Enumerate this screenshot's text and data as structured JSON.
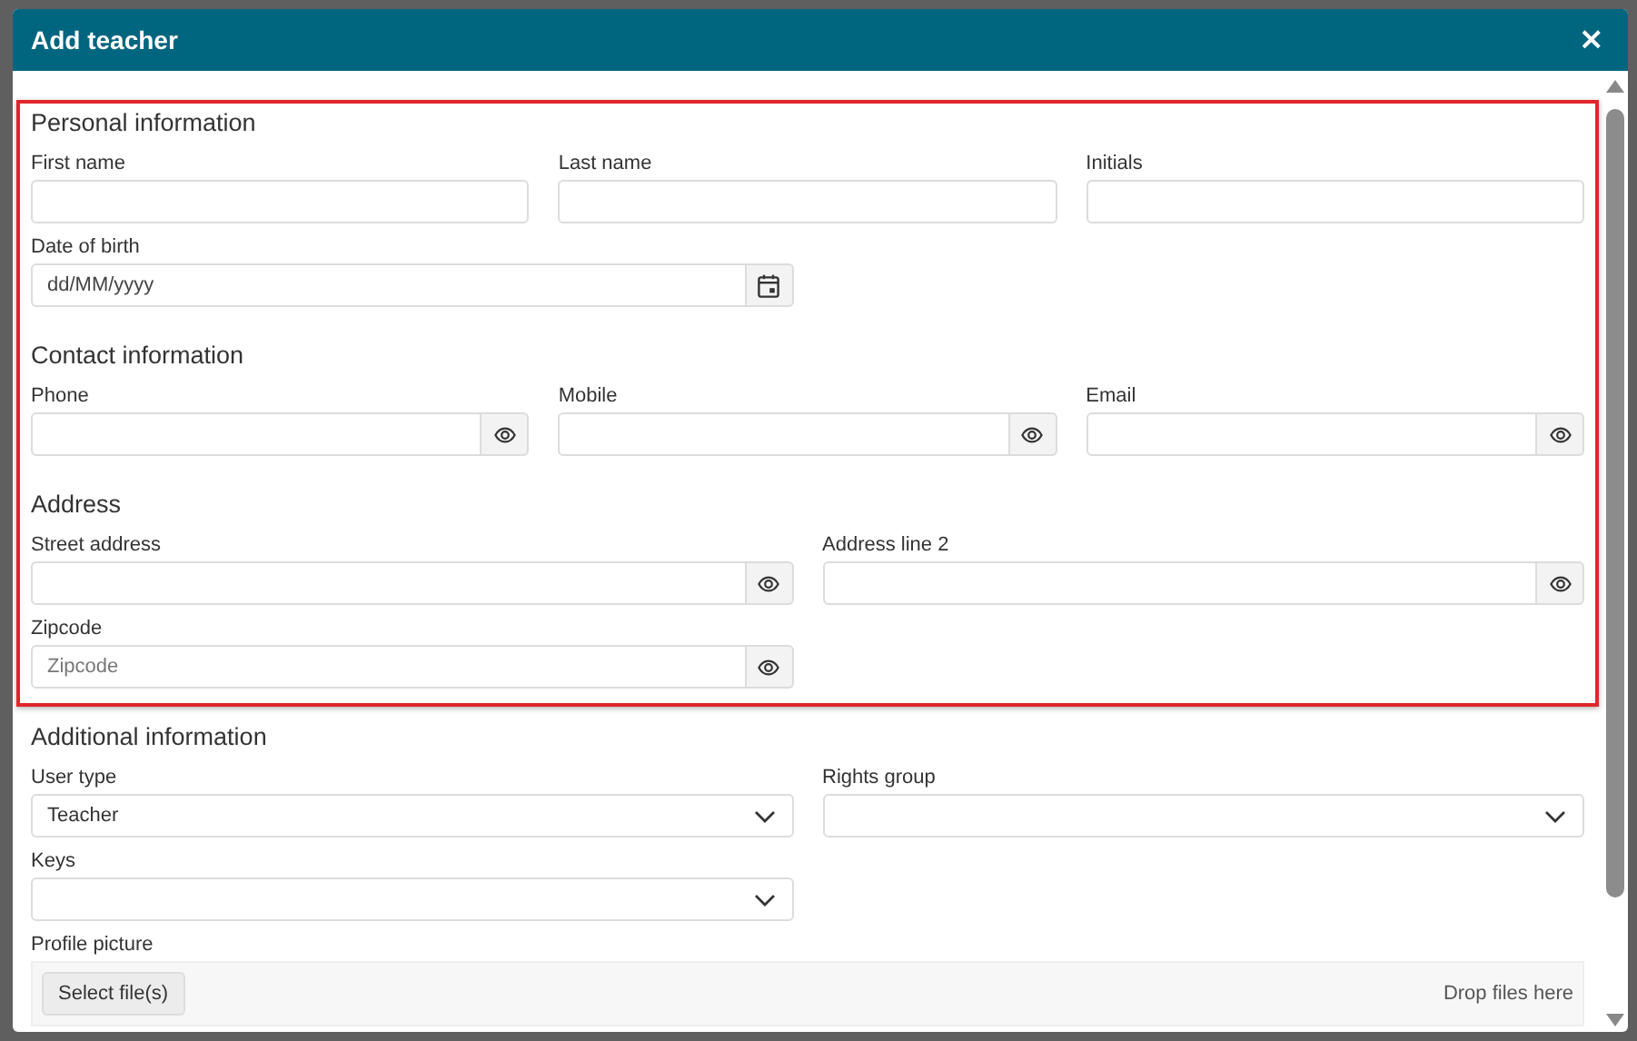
{
  "dialog": {
    "title": "Add teacher",
    "close": "×"
  },
  "groups": [
    {
      "highlighted": true,
      "sections": [
        {
          "title": "Personal information",
          "rows": [
            {
              "fields": [
                {
                  "kind": "text",
                  "label": "First name"
                },
                {
                  "kind": "text",
                  "label": "Last name"
                },
                {
                  "kind": "text",
                  "label": "Initials"
                }
              ]
            },
            {
              "fields": [
                {
                  "kind": "date",
                  "label": "Date of birth",
                  "placeholder": "dd/MM/yyyy"
                }
              ]
            }
          ]
        },
        {
          "title": "Contact information",
          "rows": [
            {
              "fields": [
                {
                  "kind": "secret",
                  "label": "Phone"
                },
                {
                  "kind": "secret",
                  "label": "Mobile"
                },
                {
                  "kind": "secret",
                  "label": "Email"
                }
              ]
            }
          ]
        },
        {
          "title": "Address",
          "rows": [
            {
              "fields": [
                {
                  "kind": "secret",
                  "label": "Street address"
                },
                {
                  "kind": "secret",
                  "label": "Address line 2"
                }
              ]
            },
            {
              "fields": [
                {
                  "kind": "secret",
                  "label": "Zipcode",
                  "placeholder": "Zipcode"
                }
              ]
            }
          ]
        }
      ]
    },
    {
      "highlighted": false,
      "sections": [
        {
          "title": "Additional information",
          "rows": [
            {
              "fields": [
                {
                  "kind": "select",
                  "label": "User type",
                  "value": "Teacher"
                },
                {
                  "kind": "select",
                  "label": "Rights group"
                }
              ]
            },
            {
              "fields": [
                {
                  "kind": "select",
                  "label": "Keys"
                }
              ]
            },
            {
              "fields": [
                {
                  "kind": "upload",
                  "label": "Profile picture",
                  "button": "Select file(s)",
                  "hint": "Drop files here"
                }
              ]
            }
          ]
        }
      ]
    }
  ]
}
